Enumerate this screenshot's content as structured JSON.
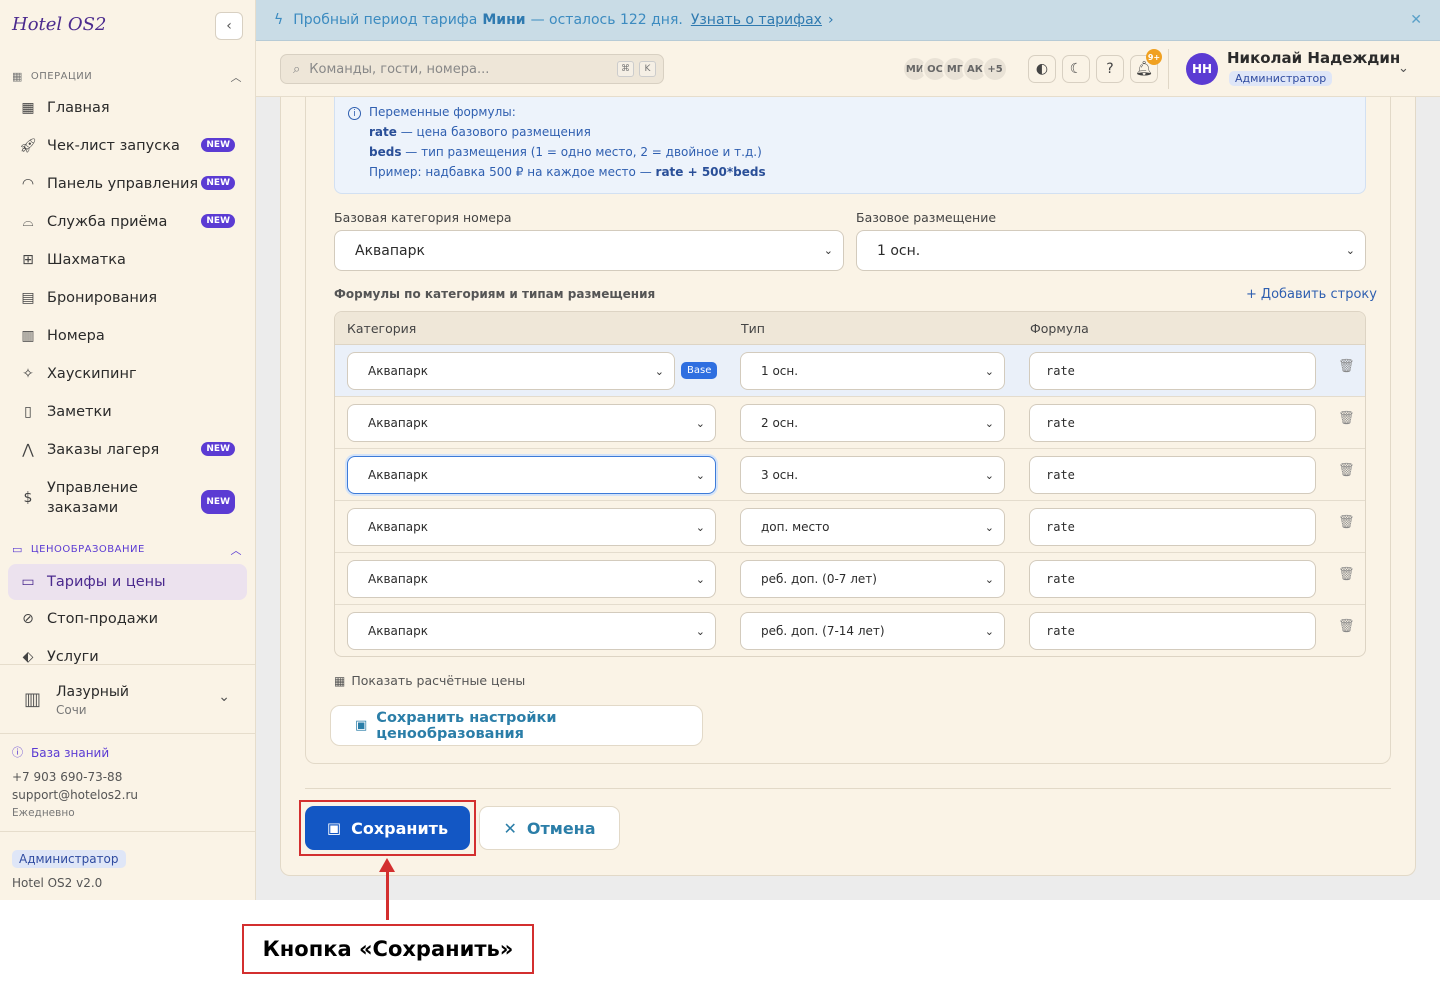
{
  "app": {
    "brand": "Hotel OS2",
    "collapse_icon": "chevron-left-icon"
  },
  "sidebar": {
    "sections": [
      {
        "title": "ОПЕРАЦИИ"
      },
      {
        "title": "ЦЕНООБРАЗОВАНИЕ"
      }
    ],
    "items": [
      {
        "label": "Главная",
        "icon": "dashboard-icon",
        "badge": ""
      },
      {
        "label": "Чек-лист запуска",
        "icon": "rocket-icon",
        "badge": "NEW"
      },
      {
        "label": "Панель управления",
        "icon": "gauge-icon",
        "badge": "NEW"
      },
      {
        "label": "Служба приёма",
        "icon": "bell-desk-icon",
        "badge": "NEW"
      },
      {
        "label": "Шахматка",
        "icon": "grid-icon",
        "badge": ""
      },
      {
        "label": "Бронирования",
        "icon": "clipboard-icon",
        "badge": ""
      },
      {
        "label": "Номера",
        "icon": "building-icon",
        "badge": ""
      },
      {
        "label": "Хаускипинг",
        "icon": "sparkle-icon",
        "badge": ""
      },
      {
        "label": "Заметки",
        "icon": "note-icon",
        "badge": ""
      },
      {
        "label": "Заказы лагеря",
        "icon": "tent-icon",
        "badge": "NEW"
      },
      {
        "label": "Управление заказами",
        "icon": "dollar-icon",
        "badge": "NEW"
      },
      {
        "label": "Тарифы и цены",
        "icon": "card-icon",
        "badge": ""
      },
      {
        "label": "Стоп-продажи",
        "icon": "ban-icon",
        "badge": ""
      },
      {
        "label": "Услуги",
        "icon": "tag-icon",
        "badge": ""
      }
    ],
    "hotel": {
      "name": "Лазурный",
      "city": "Сочи"
    },
    "support": {
      "kb_label": "База знаний",
      "phone": "+7 903 690-73-88",
      "email": "support@hotelos2.ru",
      "hours": "Ежедневно"
    },
    "role": "Администратор",
    "version": "Hotel OS2 v2.0"
  },
  "banner": {
    "text_before": "Пробный период тарифа",
    "plan": "Мини",
    "text_after": "— осталось 122 дня.",
    "link": "Узнать о тарифах",
    "link_chev": "›",
    "close": "✕"
  },
  "header": {
    "search_placeholder": "Команды, гости, номера...",
    "kbd1": "⌘",
    "kbd2": "K",
    "avatars": [
      "МИ",
      "ОС",
      "МГ",
      "АК",
      "+5"
    ],
    "bell_count": "9+",
    "user_initials": "НН",
    "user_name": "Николай Надеждин",
    "user_role": "Администратор"
  },
  "info": {
    "title": "Переменные формулы:",
    "rate_var": "rate",
    "rate_desc": "— цена базового размещения",
    "beds_var": "beds",
    "beds_desc": "— тип размещения (1 = одно место, 2 = двойное и т.д.)",
    "example_prefix": "Пример: надбавка 500 ₽ на каждое место —",
    "example_formula": "rate + 500*beds"
  },
  "form": {
    "base_category_label": "Базовая категория номера",
    "base_category_value": "Аквапарк",
    "base_occupancy_label": "Базовое размещение",
    "base_occupancy_value": "1 осн.",
    "formulas_title": "Формулы по категориям и типам размещения",
    "add_row": "Добавить строку",
    "columns": [
      "Категория",
      "Тип",
      "Формула"
    ],
    "base_tag": "Base",
    "rows": [
      {
        "category": "Аквапарк",
        "type": "1 осн.",
        "formula": "rate"
      },
      {
        "category": "Аквапарк",
        "type": "2 осн.",
        "formula": "rate"
      },
      {
        "category": "Аквапарк",
        "type": "3 осн.",
        "formula": "rate"
      },
      {
        "category": "Аквапарк",
        "type": "доп. место",
        "formula": "rate"
      },
      {
        "category": "Аквапарк",
        "type": "реб. доп. (0-7 лет)",
        "formula": "rate"
      },
      {
        "category": "Аквапарк",
        "type": "реб. доп. (7-14 лет)",
        "formula": "rate"
      }
    ],
    "show_calc": "Показать расчётные цены",
    "save_pricing": "Сохранить настройки ценообразования"
  },
  "actions": {
    "save": "Сохранить",
    "cancel": "Отмена"
  },
  "annotation": {
    "callout": "Кнопка «Сохранить»",
    "color": "#d32f2f"
  }
}
